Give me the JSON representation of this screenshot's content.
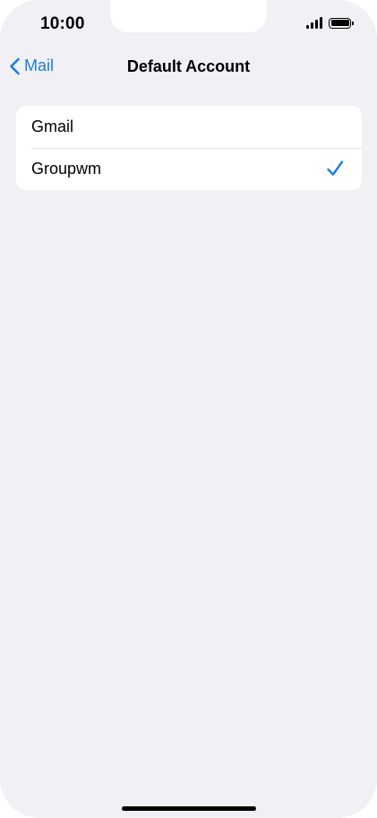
{
  "status_bar": {
    "time": "10:00",
    "signal_icon": "signal-bars-icon",
    "battery_icon": "battery-full-icon",
    "battery_level": 1.0
  },
  "nav": {
    "back_label": "Mail",
    "back_icon": "chevron-left-icon",
    "title": "Default Account"
  },
  "accounts": [
    {
      "label": "Gmail",
      "selected": false
    },
    {
      "label": "Groupwm",
      "selected": true
    }
  ],
  "colors": {
    "accent": "#1b7de0",
    "background": "#f0f0f5",
    "card": "#ffffff"
  }
}
